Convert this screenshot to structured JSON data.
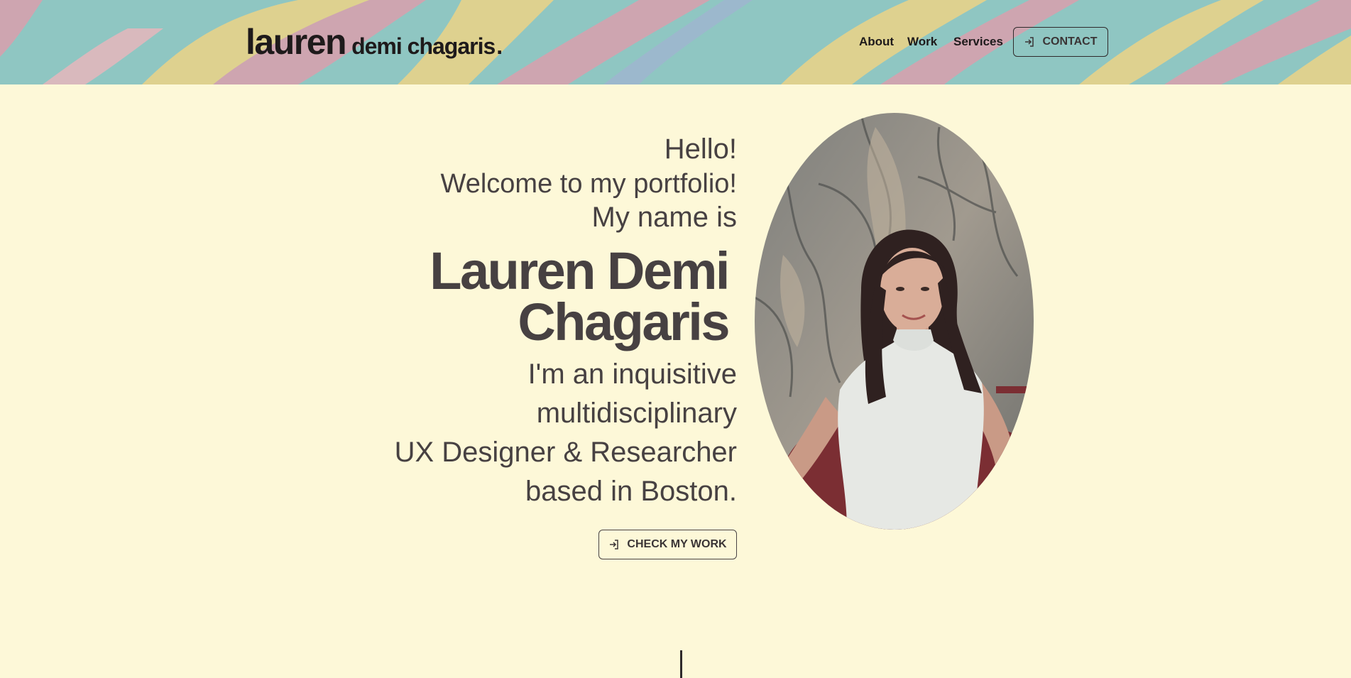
{
  "header": {
    "logo_first": "lauren",
    "logo_rest": "demi chagaris",
    "logo_dot": ".",
    "nav": [
      {
        "label": "About"
      },
      {
        "label": "Work"
      },
      {
        "label": "Services"
      }
    ],
    "contact_label": "CONTACT",
    "contact_icon": "sign-in-icon"
  },
  "hero": {
    "greeting": "Hello!",
    "welcome": "Welcome to my portfolio!",
    "intro": "My name is",
    "name_line1": "Lauren Demi",
    "name_line2": "Chagaris",
    "desc_lines": [
      "I'm an inquisitive",
      "multidisciplinary",
      "UX Designer & Researcher",
      "based in Boston."
    ],
    "cta_label": "CHECK MY WORK",
    "cta_icon": "sign-in-icon"
  },
  "colors": {
    "background": "#fdf8d8",
    "text": "#474142",
    "paint_teal": "#8fc6c2",
    "paint_yellow": "#ecd487",
    "paint_pink": "#d9a0ae"
  }
}
